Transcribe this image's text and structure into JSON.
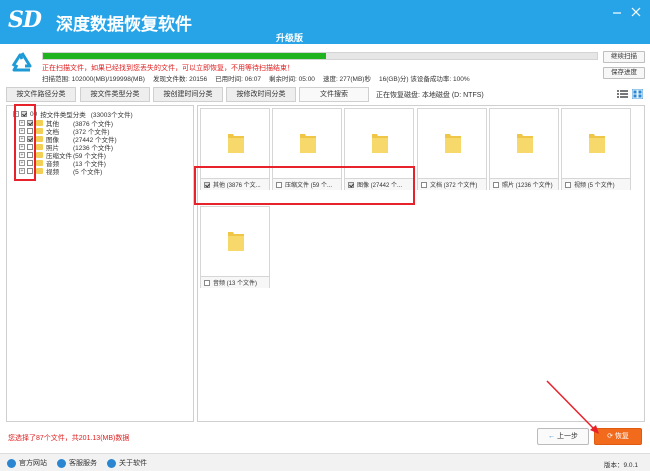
{
  "titlebar": {
    "logo": "SD",
    "title": "深度数据恢复软件",
    "edition": "升级版"
  },
  "scan": {
    "progress_fraction": 0.51,
    "warning": "正在扫描文件，如果已经找到您丢失的文件，可以立即恢复，不用等待扫描结束！",
    "stats": {
      "range": "扫描范围: 102000(MB)/199998(MB)",
      "found": "发现文件数: 20156",
      "elapsed": "已用时间: 06:07",
      "remaining": "剩余时间: 05:00",
      "speed": "速度: 277(MB)秒",
      "success": "16(GB)分)    该设备成功率: 100%"
    },
    "continue_label": "继续扫描",
    "save_label": "保存进度"
  },
  "tabs": [
    {
      "label": "按文件路径分类",
      "active": false
    },
    {
      "label": "按文件类型分类",
      "active": false
    },
    {
      "label": "按创建时间分类",
      "active": false
    },
    {
      "label": "按修改时间分类",
      "active": false
    },
    {
      "label": "文件搜索",
      "active": true
    }
  ],
  "current_disk": "正在恢复磁盘: 本地磁盘 (D: NTFS)",
  "tree": {
    "root": {
      "prefix": "00",
      "label": "按文件类型分类",
      "count": "(33003个文件)"
    },
    "items": [
      {
        "label": "其他",
        "count": "(3876 个文件)",
        "checked": true
      },
      {
        "label": "文档",
        "count": "(372 个文件)",
        "checked": false
      },
      {
        "label": "图像",
        "count": "(27442 个文件)",
        "checked": true
      },
      {
        "label": "照片",
        "count": "(1236 个文件)",
        "checked": false
      },
      {
        "label": "压缩文件",
        "count": "(59 个文件)",
        "checked": false
      },
      {
        "label": "音频",
        "count": "(13 个文件)",
        "checked": false
      },
      {
        "label": "视频",
        "count": "(5 个文件)",
        "checked": false
      }
    ]
  },
  "tiles": [
    {
      "caption": "其他  (3876 个文...",
      "checked": true
    },
    {
      "caption": "压缩文件  (59 个...",
      "checked": false
    },
    {
      "caption": "图像  (27442 个...",
      "checked": true
    },
    {
      "caption": "文档  (372 个文件)",
      "checked": false
    },
    {
      "caption": "照片  (1236 个文件)",
      "checked": false
    },
    {
      "caption": "视频  (5 个文件)",
      "checked": false
    },
    {
      "caption": "音频  (13 个文件)",
      "checked": false
    }
  ],
  "selection_status": "您选择了87个文件，共201.13(MB)数据",
  "buttons": {
    "prev": "上一步",
    "recover": "恢复"
  },
  "footer": {
    "website": "官方网站",
    "support": "客服服务",
    "about": "关于软件",
    "version": "版本：9.0.1"
  },
  "colors": {
    "titlebar": "#27a4e8",
    "progress": "#1fb41f",
    "warning_text": "#e02020",
    "highlight_box": "#e8222a",
    "recover_button": "#f26b1d",
    "folder": "#f3cf55"
  }
}
